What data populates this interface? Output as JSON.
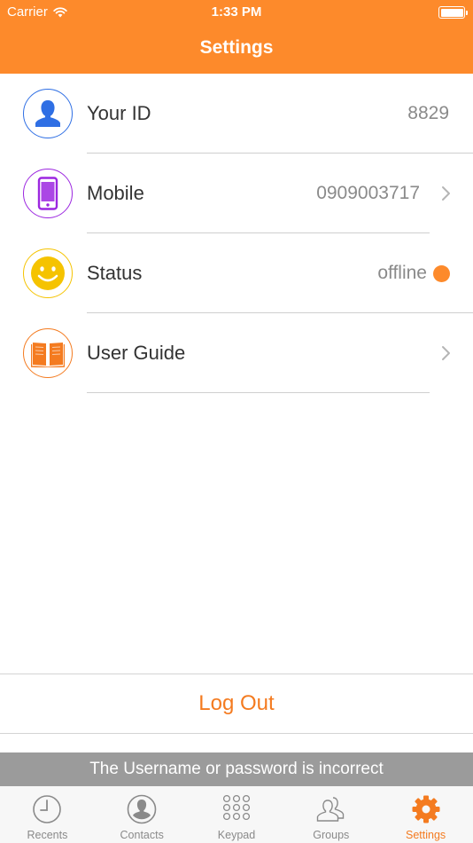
{
  "status_bar": {
    "carrier": "Carrier",
    "time": "1:33 PM"
  },
  "header": {
    "title": "Settings"
  },
  "settings": [
    {
      "label": "Your ID",
      "value": "8829",
      "icon": "person-icon",
      "color": "#2F6FE4"
    },
    {
      "label": "Mobile",
      "value": "0909003717",
      "icon": "phone-icon",
      "color": "#9C27E0"
    },
    {
      "label": "Status",
      "value": "offline",
      "icon": "smiley-icon",
      "color": "#F5C300",
      "status_dot_color": "#FD8A2B"
    },
    {
      "label": "User Guide",
      "value": "",
      "icon": "book-icon",
      "color": "#F47B20"
    }
  ],
  "logout_label": "Log Out",
  "error_banner": "The Username or password is incorrect",
  "tabs": [
    {
      "label": "Recents",
      "icon": "clock-icon"
    },
    {
      "label": "Contacts",
      "icon": "contact-icon"
    },
    {
      "label": "Keypad",
      "icon": "keypad-icon"
    },
    {
      "label": "Groups",
      "icon": "groups-icon"
    },
    {
      "label": "Settings",
      "icon": "gear-icon",
      "active": true
    }
  ],
  "colors": {
    "accent": "#FD8A2B",
    "text": "#333333",
    "secondary": "#8A8A8A"
  }
}
